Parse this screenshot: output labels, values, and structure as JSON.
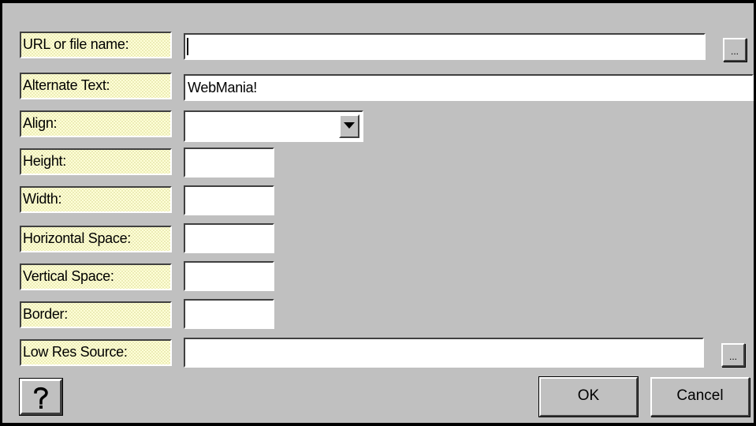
{
  "dialog": {
    "fields": {
      "url": {
        "label": "URL or file name:",
        "value": ""
      },
      "alt_text": {
        "label": "Alternate Text:",
        "value": "WebMania!"
      },
      "align": {
        "label": "Align:",
        "value": ""
      },
      "height": {
        "label": "Height:",
        "value": ""
      },
      "width": {
        "label": "Width:",
        "value": ""
      },
      "hspace": {
        "label": "Horizontal Space:",
        "value": ""
      },
      "vspace": {
        "label": "Vertical Space:",
        "value": ""
      },
      "border": {
        "label": "Border:",
        "value": ""
      },
      "lowsrc": {
        "label": "Low Res Source:",
        "value": ""
      }
    },
    "browse_label": "...",
    "help_icon": "question-mark-icon",
    "ok_label": "OK",
    "cancel_label": "Cancel"
  }
}
